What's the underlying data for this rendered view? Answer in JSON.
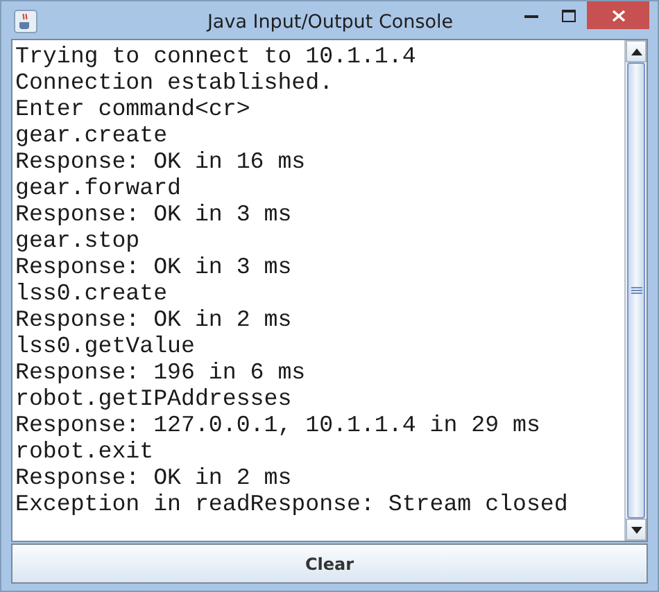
{
  "window": {
    "title": "Java Input/Output Console"
  },
  "console": {
    "lines": [
      "Trying to connect to 10.1.1.4",
      "Connection established.",
      "Enter command<cr>",
      "gear.create",
      "Response: OK in 16 ms",
      "gear.forward",
      "Response: OK in 3 ms",
      "gear.stop",
      "Response: OK in 3 ms",
      "lss0.create",
      "Response: OK in 2 ms",
      "lss0.getValue",
      "Response: 196 in 6 ms",
      "robot.getIPAddresses",
      "Response: 127.0.0.1, 10.1.1.4 in 29 ms",
      "robot.exit",
      "Response: OK in 2 ms",
      "Exception in readResponse: Stream closed"
    ]
  },
  "buttons": [
    {
      "label": "Clear"
    }
  ]
}
